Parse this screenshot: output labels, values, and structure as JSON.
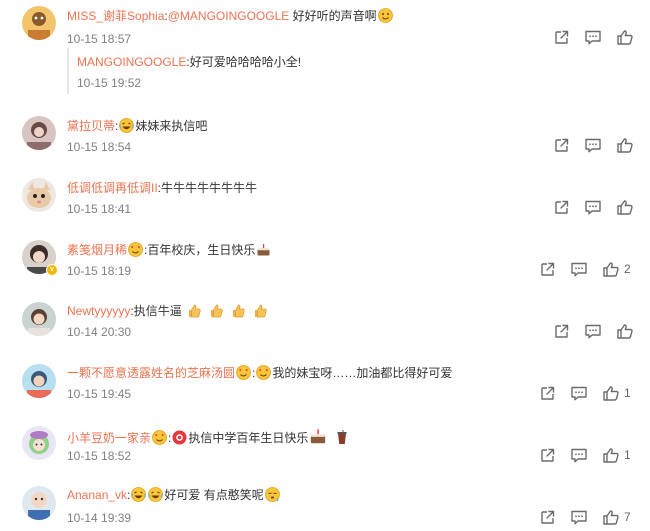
{
  "colors": {
    "username": "#eb7350",
    "meta": "#808080",
    "icon": "#6b6b6b"
  },
  "comments": [
    {
      "user": "MISS_谢菲Sophia",
      "sep": ":",
      "mention": "@MANGOINGOOGLE",
      "text": " 好好听的声音啊",
      "time": "10-15 18:57",
      "likes": "",
      "reply": {
        "user": "MANGOINGOOGLE",
        "sep": ":",
        "text": "好可爱哈哈哈哈小全!",
        "time": "10-15 19:52"
      }
    },
    {
      "user": "黛拉贝蒂",
      "sep": ":",
      "text": "妹妹来执信吧",
      "time": "10-15 18:54",
      "likes": ""
    },
    {
      "user": "低调低调再低调II",
      "sep": ":",
      "text": "牛牛牛牛牛牛牛牛",
      "time": "10-15 18:41",
      "likes": ""
    },
    {
      "user": "素笺烟月稀",
      "sep": ":",
      "text": "百年校庆，生日快乐",
      "time": "10-15 18:19",
      "likes": "2"
    },
    {
      "user": "Newtyyyyyy",
      "sep": ":",
      "text": "执信牛逼",
      "time": "10-14 20:30",
      "likes": ""
    },
    {
      "user": "一颗不愿意透露姓名的芝麻汤圆",
      "sep": ":",
      "text": "我的妹宝呀……加油都比得好可爱",
      "time": "10-15 19:45",
      "likes": "1"
    },
    {
      "user": "小羊豆奶一家亲",
      "sep": ":",
      "text": "执信中学百年生日快乐",
      "time": "10-15 18:52",
      "likes": "1"
    },
    {
      "user": "Ananan_vk",
      "sep": ":",
      "text": "好可爱 有点憨笑呢",
      "time": "10-14 19:39",
      "likes": "7"
    }
  ],
  "icons": {
    "share": "share-icon",
    "comment": "comment-icon",
    "like": "thumbs-up-icon"
  }
}
